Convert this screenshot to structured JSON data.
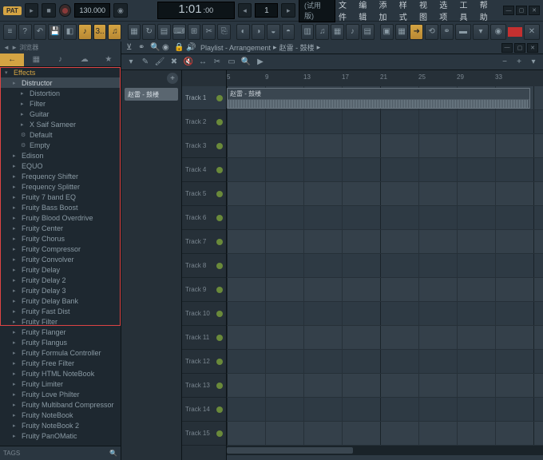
{
  "topbar": {
    "pat_badge": "PAT",
    "tempo": "130.000",
    "time": {
      "big": "1:01",
      "small": ":00"
    },
    "pattern_num": "1",
    "version_label": "(试用版)"
  },
  "menu": {
    "file": "文件",
    "edit": "编辑",
    "add": "添加",
    "patterns": "样式",
    "view": "视图",
    "options": "选项",
    "tools": "工具",
    "help": "帮助"
  },
  "browser": {
    "header": "◄ ► 浏览器",
    "tabs": [
      "←",
      "▦",
      "♪",
      "☁",
      "★"
    ],
    "effects_label": "Effects",
    "tags_label": "TAGS",
    "items": [
      {
        "label": "Distructor",
        "indent": 1,
        "sel": true
      },
      {
        "label": "Distortion",
        "indent": 2
      },
      {
        "label": "Filter",
        "indent": 2
      },
      {
        "label": "Guitar",
        "indent": 2
      },
      {
        "label": "X Saif Sameer",
        "indent": 2
      },
      {
        "label": "Default",
        "indent": 2,
        "icon": "preset"
      },
      {
        "label": "Empty",
        "indent": 2,
        "icon": "preset"
      },
      {
        "label": "Edison",
        "indent": 1
      },
      {
        "label": "EQUO",
        "indent": 1
      },
      {
        "label": "Frequency Shifter",
        "indent": 1
      },
      {
        "label": "Frequency Splitter",
        "indent": 1
      },
      {
        "label": "Fruity 7 band EQ",
        "indent": 1
      },
      {
        "label": "Fruity Bass Boost",
        "indent": 1
      },
      {
        "label": "Fruity Blood Overdrive",
        "indent": 1
      },
      {
        "label": "Fruity Center",
        "indent": 1
      },
      {
        "label": "Fruity Chorus",
        "indent": 1
      },
      {
        "label": "Fruity Compressor",
        "indent": 1
      },
      {
        "label": "Fruity Convolver",
        "indent": 1
      },
      {
        "label": "Fruity Delay",
        "indent": 1
      },
      {
        "label": "Fruity Delay 2",
        "indent": 1
      },
      {
        "label": "Fruity Delay 3",
        "indent": 1
      },
      {
        "label": "Fruity Delay Bank",
        "indent": 1
      },
      {
        "label": "Fruity Fast Dist",
        "indent": 1
      },
      {
        "label": "Fruity Filter",
        "indent": 1
      },
      {
        "label": "Fruity Flanger",
        "indent": 1
      },
      {
        "label": "Fruity Flangus",
        "indent": 1
      },
      {
        "label": "Fruity Formula Controller",
        "indent": 1
      },
      {
        "label": "Fruity Free Filter",
        "indent": 1
      },
      {
        "label": "Fruity HTML NoteBook",
        "indent": 1
      },
      {
        "label": "Fruity Limiter",
        "indent": 1
      },
      {
        "label": "Fruity Love Philter",
        "indent": 1
      },
      {
        "label": "Fruity Multiband Compressor",
        "indent": 1
      },
      {
        "label": "Fruity NoteBook",
        "indent": 1
      },
      {
        "label": "Fruity NoteBook 2",
        "indent": 1
      },
      {
        "label": "Fruity PanOMatic",
        "indent": 1
      }
    ]
  },
  "playlist": {
    "title_prefix": "Playlist - Arrangement",
    "project": "赵雷 - 鼓楼",
    "pattern_name": "赵雷 - 鼓楼",
    "clip_name": "赵雷 - 鼓楼",
    "ruler_marks": [
      "5",
      "9",
      "13",
      "17",
      "21",
      "25",
      "29",
      "33"
    ],
    "tracks": [
      "Track 1",
      "Track 2",
      "Track 3",
      "Track 4",
      "Track 5",
      "Track 6",
      "Track 7",
      "Track 8",
      "Track 9",
      "Track 10",
      "Track 11",
      "Track 12",
      "Track 13",
      "Track 14",
      "Track 15"
    ]
  }
}
